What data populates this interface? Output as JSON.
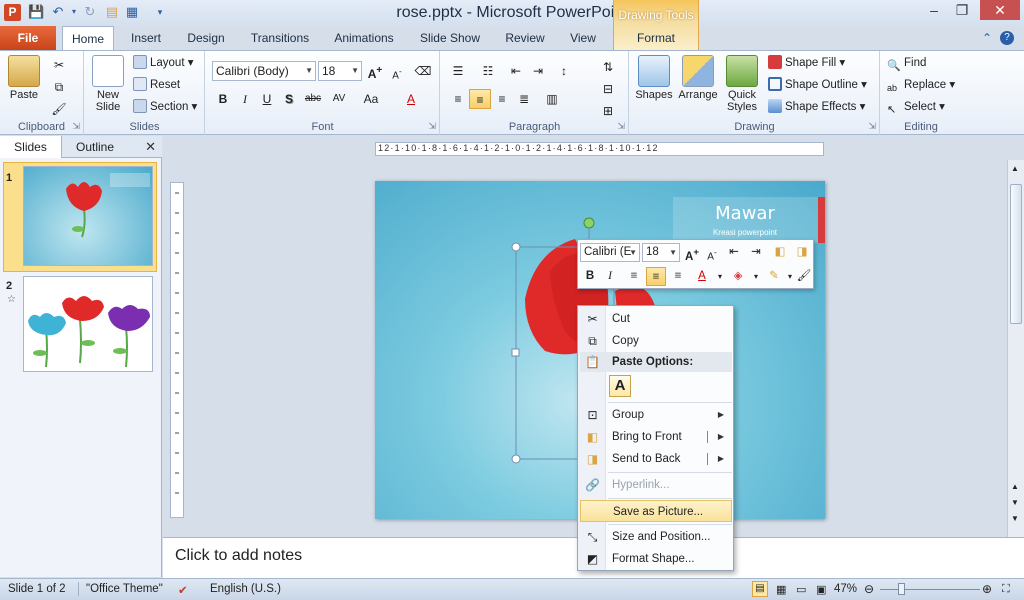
{
  "window": {
    "title": "rose.pptx  -  Microsoft PowerPoint",
    "contextual_tab_group": "Drawing Tools",
    "app_logo": "P"
  },
  "ribbon_tabs": [
    "File",
    "Home",
    "Insert",
    "Design",
    "Transitions",
    "Animations",
    "Slide Show",
    "Review",
    "View",
    "Format"
  ],
  "ribbon": {
    "clipboard": {
      "label": "Clipboard",
      "paste": "Paste"
    },
    "slides": {
      "label": "Slides",
      "new_slide": "New Slide",
      "layout": "Layout",
      "reset": "Reset",
      "section": "Section"
    },
    "font": {
      "label": "Font",
      "font_name": "Calibri (Body)",
      "font_size": "18",
      "buttons": [
        "B",
        "I",
        "U",
        "S",
        "abc",
        "AV",
        "Aa",
        "A"
      ]
    },
    "paragraph": {
      "label": "Paragraph"
    },
    "drawing": {
      "label": "Drawing",
      "shapes": "Shapes",
      "arrange": "Arrange",
      "quick_styles": "Quick Styles",
      "shape_fill": "Shape Fill",
      "shape_outline": "Shape Outline",
      "shape_effects": "Shape Effects"
    },
    "editing": {
      "label": "Editing",
      "find": "Find",
      "replace": "Replace",
      "select": "Select"
    }
  },
  "slides_pane": {
    "tabs": [
      "Slides",
      "Outline"
    ],
    "thumbnails": [
      {
        "number": "1"
      },
      {
        "number": "2"
      }
    ]
  },
  "slide": {
    "title": "Mawar",
    "subtitle": "Kreasi powerpoint"
  },
  "ruler_text": "12·1·10·1·8·1·6·1·4·1·2·1·0·1·2·1·4·1·6·1·8·1·10·1·12",
  "notes_placeholder": "Click to add notes",
  "mini_toolbar": {
    "font_name": "Calibri (E",
    "font_size": "18"
  },
  "context_menu": {
    "cut": "Cut",
    "copy": "Copy",
    "paste_options": "Paste Options:",
    "paste_keep_text": "A",
    "group": "Group",
    "bring_to_front": "Bring to Front",
    "send_to_back": "Send to Back",
    "hyperlink": "Hyperlink...",
    "save_as_picture": "Save as Picture...",
    "size_and_position": "Size and Position...",
    "format_shape": "Format Shape..."
  },
  "status_bar": {
    "slide_info": "Slide 1 of 2",
    "theme": "\"Office Theme\"",
    "language": "English (U.S.)",
    "zoom": "47%"
  },
  "colors": {
    "accent_file": "#d24726",
    "slide_bg": "#4aa9cb",
    "rose_red": "#e02a2a",
    "hover": "#fbe29a"
  }
}
